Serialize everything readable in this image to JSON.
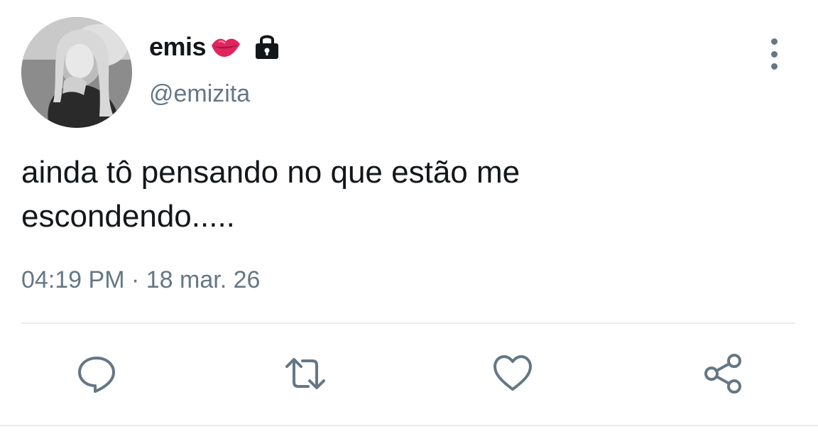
{
  "tweet": {
    "display_name": "emis",
    "name_emoji": "lips-icon",
    "protected_icon": "lock-icon",
    "handle": "@emizita",
    "text_line1": "ainda tô pensando no que estão me",
    "text_line2": "escondendo.....",
    "time": "04:19 PM",
    "separator": " · ",
    "date": "18 mar. 26"
  },
  "actions": [
    "reply-icon",
    "retweet-icon",
    "like-icon",
    "share-icon"
  ],
  "colors": {
    "text": "#14171a",
    "secondary": "#657786",
    "divider": "#e6ecf0",
    "lips": "#e0245e"
  }
}
